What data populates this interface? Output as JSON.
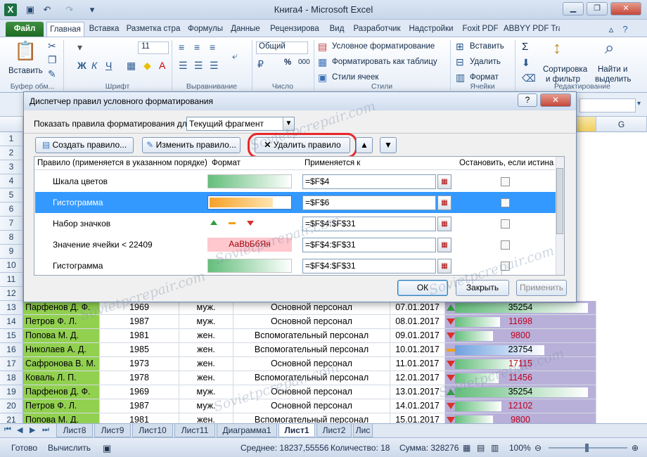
{
  "window": {
    "title": "Книга4  -  Microsoft Excel"
  },
  "tabs": [
    "Файл",
    "Главная",
    "Вставка",
    "Разметка стра",
    "Формулы",
    "Данные",
    "Рецензирова",
    "Вид",
    "Разработчик",
    "Надстройки",
    "Foxit PDF",
    "ABBYY PDF Trar"
  ],
  "ribbon": {
    "paste": "Вставить",
    "clipboard_group": "Буфер обм...",
    "font_group": "Шрифт",
    "align_group": "Выравнивание",
    "number_group": "Число",
    "styles_group": "Стили",
    "cells_group": "Ячейки",
    "editing_group": "Редактирование",
    "font_size": "11",
    "number_format": "Общий",
    "cond_format": "Условное форматирование",
    "format_table": "Форматировать как таблицу",
    "cell_styles": "Стили ячеек",
    "insert": "Вставить",
    "delete": "Удалить",
    "format": "Формат",
    "sort": "Сортировка",
    "sort2": "и фильтр",
    "find": "Найти и",
    "find2": "выделить",
    "sigma": "Σ",
    "pct": "%",
    "thousands": "000"
  },
  "dialog": {
    "title": "Диспетчер правил условного форматирования",
    "show_label": "Показать правила форматирования для:",
    "show_value": "Текущий фрагмент",
    "create": "Создать правило...",
    "edit": "Изменить правило...",
    "delete": "Удалить правило",
    "col_rule": "Правило (применяется в указанном порядке)",
    "col_format": "Формат",
    "col_applies": "Применяется к",
    "col_stop": "Остановить, если истина",
    "rules": [
      {
        "name": "Шкала цветов",
        "applies": "=$F$4",
        "sample": ""
      },
      {
        "name": "Гистограмма",
        "applies": "=$F$6",
        "sample": ""
      },
      {
        "name": "Набор значков",
        "applies": "=$F$4:$F$31",
        "sample": ""
      },
      {
        "name": "Значение ячейки < 22409",
        "applies": "=$F$4:$F$31",
        "sample": "АаВbБбЯя"
      },
      {
        "name": "Гистограмма",
        "applies": "=$F$4:$F$31",
        "sample": ""
      }
    ],
    "ok": "ОК",
    "close": "Закрыть",
    "apply": "Применить",
    "help": "?"
  },
  "columns": [
    "G"
  ],
  "row_numbers_top": [
    "1",
    "2",
    "3",
    "4",
    "5",
    "6",
    "7",
    "8",
    "9",
    "10",
    "11",
    "12"
  ],
  "rows": [
    {
      "n": "13",
      "name": "Парфенов Д. Ф.",
      "year": "1969",
      "sex": "муж.",
      "pos": "Основной персонал",
      "date": "07.01.2017",
      "sal": "35254",
      "sal_frac": 0.95,
      "icon": "up",
      "red": false
    },
    {
      "n": "14",
      "name": "Петров Ф. Л.",
      "year": "1987",
      "sex": "муж.",
      "pos": "Основной персонал",
      "date": "08.01.2017",
      "sal": "11698",
      "sal_frac": 0.32,
      "icon": "down",
      "red": true
    },
    {
      "n": "15",
      "name": "Попова М. Д.",
      "year": "1981",
      "sex": "жен.",
      "pos": "Вспомогательный персонал",
      "date": "09.01.2017",
      "sal": "9800",
      "sal_frac": 0.27,
      "icon": "down",
      "red": true
    },
    {
      "n": "16",
      "name": "Николаев А. Д.",
      "year": "1985",
      "sex": "жен.",
      "pos": "Вспомогательный персонал",
      "date": "10.01.2017",
      "sal": "23754",
      "sal_frac": 0.64,
      "icon": "mid",
      "red": false
    },
    {
      "n": "17",
      "name": "Сафронова В. М.",
      "year": "1973",
      "sex": "жен.",
      "pos": "Основной персонал",
      "date": "11.01.2017",
      "sal": "17115",
      "sal_frac": 0.46,
      "icon": "down",
      "red": true
    },
    {
      "n": "18",
      "name": "Коваль Л. П.",
      "year": "1978",
      "sex": "жен.",
      "pos": "Вспомогательный персонал",
      "date": "12.01.2017",
      "sal": "11456",
      "sal_frac": 0.31,
      "icon": "down",
      "red": true
    },
    {
      "n": "19",
      "name": "Парфенов Д. Ф.",
      "year": "1969",
      "sex": "муж.",
      "pos": "Основной персонал",
      "date": "13.01.2017",
      "sal": "35254",
      "sal_frac": 0.95,
      "icon": "up",
      "red": false
    },
    {
      "n": "20",
      "name": "Петров Ф. Л.",
      "year": "1987",
      "sex": "муж.",
      "pos": "Основной персонал",
      "date": "14.01.2017",
      "sal": "12102",
      "sal_frac": 0.33,
      "icon": "down",
      "red": true
    },
    {
      "n": "21",
      "name": "Попова М. Д.",
      "year": "1981",
      "sex": "жен.",
      "pos": "Вспомогательный персонал",
      "date": "15.01.2017",
      "sal": "9800",
      "sal_frac": 0.27,
      "icon": "down",
      "red": true
    }
  ],
  "sheets": [
    "Лист8",
    "Лист9",
    "Лист10",
    "Лист11",
    "Диаграмма1",
    "Лист1",
    "Лист2",
    "Лис"
  ],
  "active_sheet": "Лист1",
  "status": {
    "ready": "Готово",
    "calc": "Вычислить",
    "avg": "Среднее: 18237,55556",
    "count": "Количество: 18",
    "sum": "Сумма: 328276",
    "zoom": "100%"
  },
  "watermark": "Sovietpcrepair.com",
  "colors": {
    "name_fill": "#92d050",
    "sal_fill": "#b8b0d9",
    "selection": "#3399ff",
    "highlight_ring": "#e8262a"
  }
}
